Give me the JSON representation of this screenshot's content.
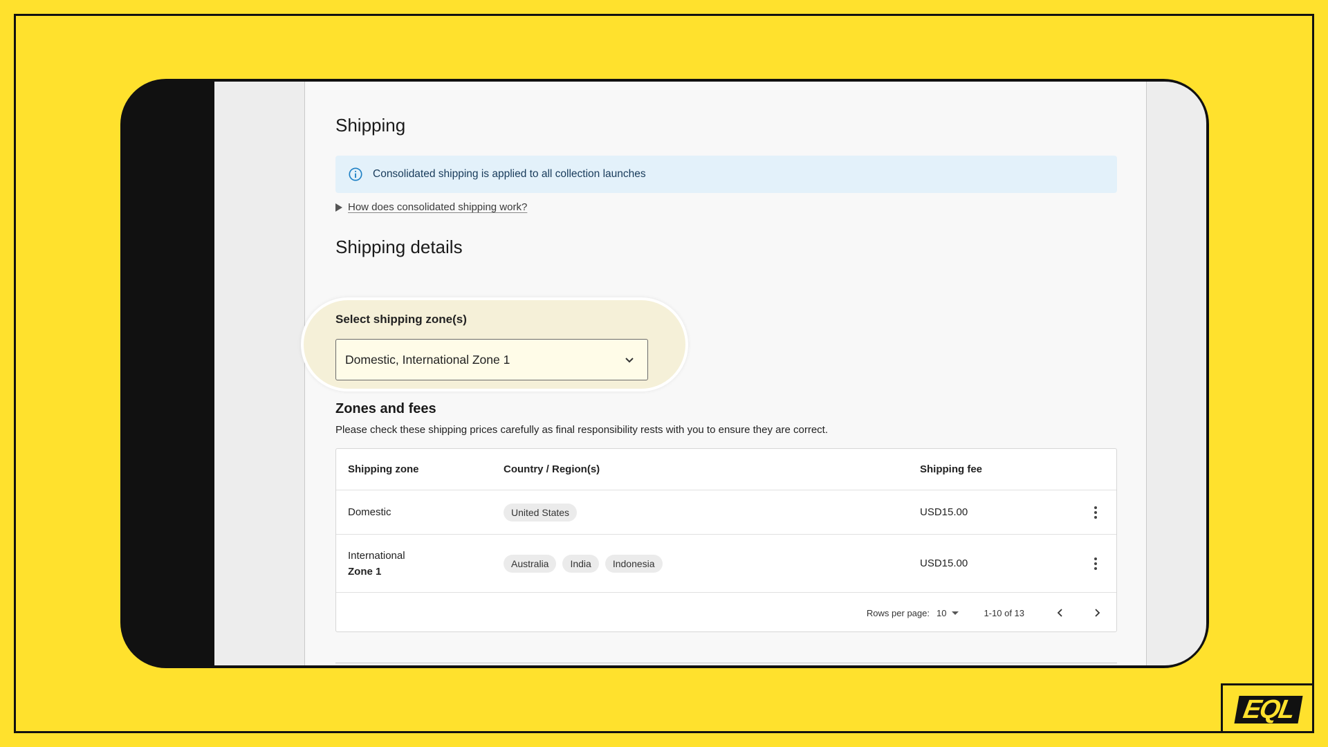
{
  "brand": {
    "logo_text": "EQL",
    "background": "#FFE12D",
    "accent": "#111111"
  },
  "page": {
    "title": "Shipping"
  },
  "banner": {
    "text": "Consolidated shipping is applied to all collection launches",
    "icon": "info-icon",
    "color": "#E3F1FA"
  },
  "disclosure": {
    "label": "How does consolidated shipping work?"
  },
  "shipping_details": {
    "title": "Shipping details",
    "zone_select": {
      "label": "Select shipping zone(s)",
      "value": "Domestic, International Zone 1"
    }
  },
  "zones": {
    "title": "Zones and fees",
    "description": "Please check these shipping prices carefully as final responsibility rests with you to ensure they are correct.",
    "columns": [
      "Shipping zone",
      "Country / Region(s)",
      "Shipping fee"
    ],
    "rows": [
      {
        "zone_line1": "Domestic",
        "regions": [
          "United States"
        ],
        "fee": "USD15.00"
      },
      {
        "zone_line1": "International",
        "zone_line2": "Zone 1",
        "regions": [
          "Australia",
          "India",
          "Indonesia"
        ],
        "fee": "USD15.00"
      }
    ],
    "pagination": {
      "rows_per_page_label": "Rows per page:",
      "rows_per_page": "10",
      "range": "1-10 of 13"
    }
  }
}
